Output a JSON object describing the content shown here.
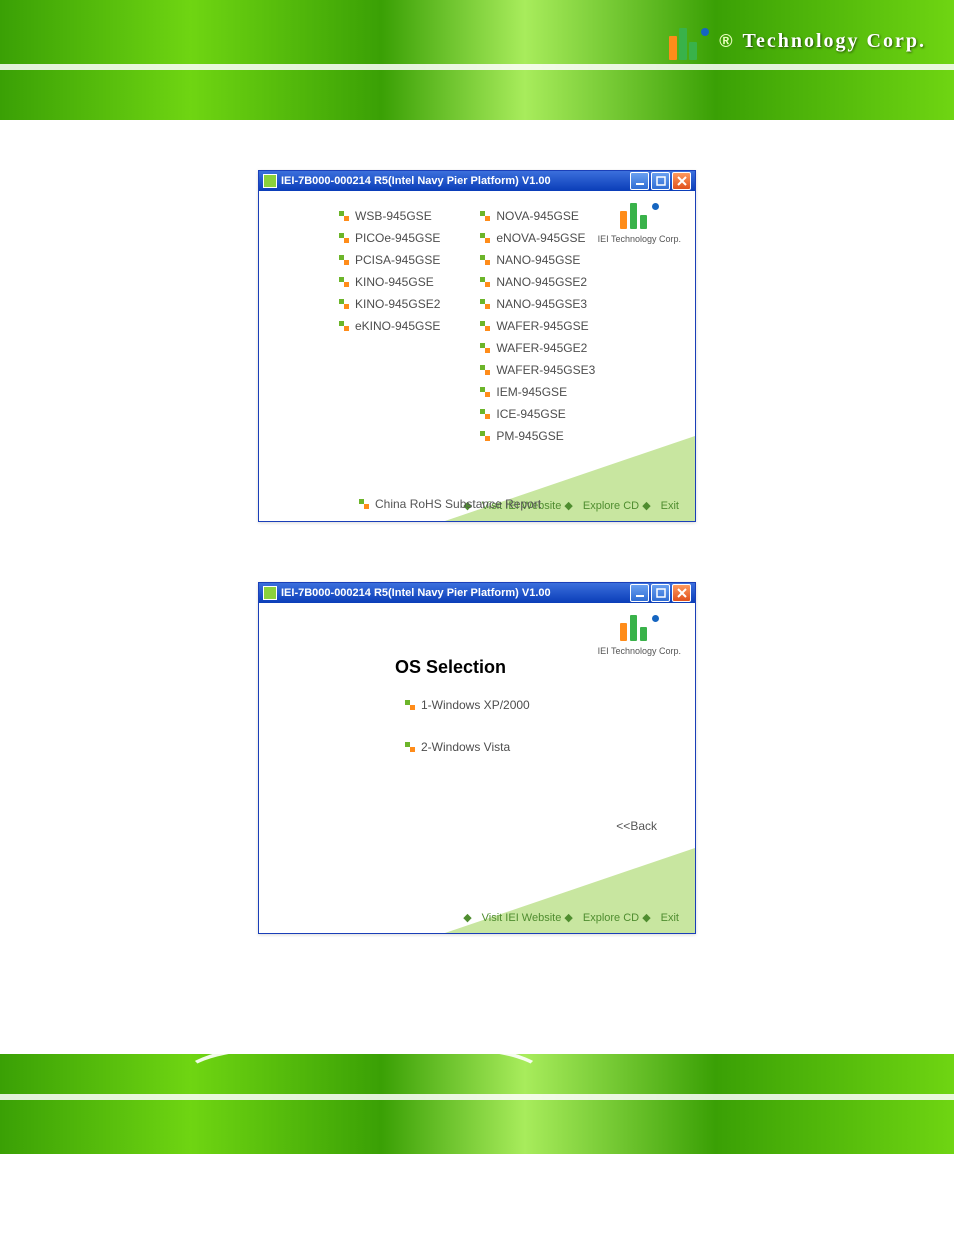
{
  "header": {
    "corp": "Technology Corp.",
    "reg_mark": "®"
  },
  "window": {
    "title": "IEI-7B000-000214 R5(Intel Navy Pier Platform) V1.00",
    "app_icon": "iei-square-icon",
    "buttons": {
      "min": "_",
      "max": "□",
      "close": "X"
    },
    "logo_sub": "IEI Technology Corp."
  },
  "screen1": {
    "col1": [
      "WSB-945GSE",
      "PICOe-945GSE",
      "PCISA-945GSE",
      "KINO-945GSE",
      "KINO-945GSE2",
      "eKINO-945GSE"
    ],
    "col2": [
      "NOVA-945GSE",
      "eNOVA-945GSE",
      "NANO-945GSE",
      "NANO-945GSE2",
      "NANO-945GSE3",
      "WAFER-945GSE",
      "WAFER-945GE2",
      "WAFER-945GSE3",
      "IEM-945GSE",
      "ICE-945GSE",
      "PM-945GSE"
    ],
    "rohs": "China RoHS Substance Report"
  },
  "footer_links": {
    "visit": "Visit IEI Website",
    "explore": "Explore CD",
    "exit": "Exit"
  },
  "screen2": {
    "heading": "OS Selection",
    "options": [
      "1-Windows XP/2000",
      "2-Windows Vista"
    ],
    "back": "<<Back"
  }
}
